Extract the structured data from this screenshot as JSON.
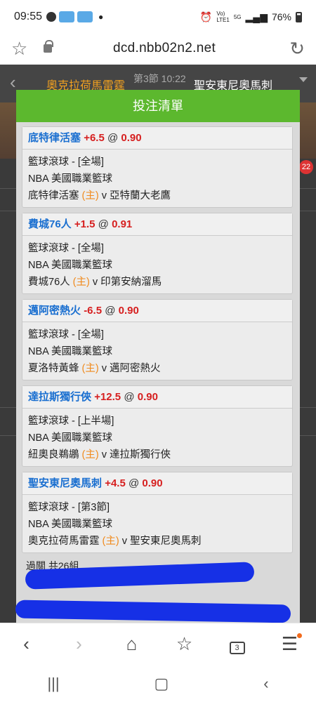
{
  "status_bar": {
    "time": "09:55",
    "battery": "76%",
    "net_top": "Vo)",
    "net_bottom": "LTE1",
    "net5g": "5G"
  },
  "browser": {
    "url": "dcd.nbb02n2.net",
    "tabs_count": "3"
  },
  "match_header": {
    "team_a": "奧克拉荷馬雷霆",
    "period": "第3節 10:22",
    "team_b": "聖安東尼奧馬刺"
  },
  "background_badge": "22",
  "modal": {
    "title": "投注清單",
    "bets": [
      {
        "team": "底特律活塞",
        "handicap": "+6.5",
        "at": "@",
        "odds": "0.90",
        "market": "籃球滾球 - [全場]",
        "league": "NBA 美國職業籃球",
        "home": "底特律活塞",
        "home_tag": "(主)",
        "vs": "v",
        "away": "亞特蘭大老鷹"
      },
      {
        "team": "費城76人",
        "handicap": "+1.5",
        "at": "@",
        "odds": "0.91",
        "market": "籃球滾球 - [全場]",
        "league": "NBA 美國職業籃球",
        "home": "費城76人",
        "home_tag": "(主)",
        "vs": "v",
        "away": "印第安納溜馬"
      },
      {
        "team": "邁阿密熱火",
        "handicap": "-6.5",
        "at": "@",
        "odds": "0.90",
        "market": "籃球滾球 - [全場]",
        "league": "NBA 美國職業籃球",
        "home": "夏洛特黃蜂",
        "home_tag": "(主)",
        "vs": "v",
        "away": "邁阿密熱火"
      },
      {
        "team": "達拉斯獨行俠",
        "handicap": "+12.5",
        "at": "@",
        "odds": "0.90",
        "market": "籃球滾球 - [上半場]",
        "league": "NBA 美國職業籃球",
        "home": "紐奧良鵜鶘",
        "home_tag": "(主)",
        "vs": "v",
        "away": "達拉斯獨行俠"
      },
      {
        "team": "聖安東尼奧馬刺",
        "handicap": "+4.5",
        "at": "@",
        "odds": "0.90",
        "market": "籃球滾球 - [第3節]",
        "league": "NBA 美國職業籃球",
        "home": "奧克拉荷馬雷霆",
        "home_tag": "(主)",
        "vs": "v",
        "away": "聖安東尼奧馬刺"
      }
    ],
    "summary": "過關 共26組"
  },
  "colors": {
    "header_green": "#5cb82e",
    "team_blue": "#1a6fd0",
    "odds_red": "#d61f1f",
    "home_orange": "#f08a1c",
    "scribble_blue": "#1630e6"
  },
  "icons": [
    "star-icon",
    "lock-icon",
    "reload-icon",
    "back-icon",
    "forward-icon",
    "home-icon",
    "bookmarks-icon",
    "tabs-icon",
    "menu-icon",
    "recents-icon",
    "home-circle-icon",
    "system-back-icon"
  ]
}
